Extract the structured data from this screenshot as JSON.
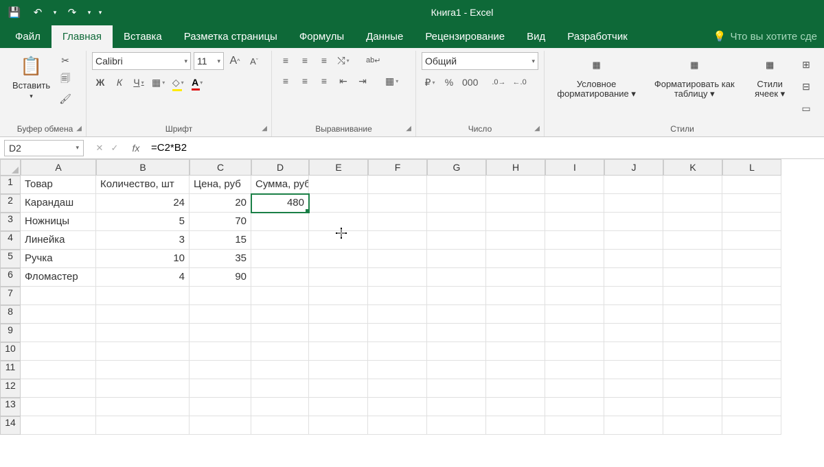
{
  "title": "Книга1  -  Excel",
  "qat_dropdown": "▾",
  "tabs": [
    "Файл",
    "Главная",
    "Вставка",
    "Разметка страницы",
    "Формулы",
    "Данные",
    "Рецензирование",
    "Вид",
    "Разработчик"
  ],
  "active_tab": 1,
  "tellme": "Что вы хотите сде",
  "clipboard": {
    "paste": "Вставить",
    "label": "Буфер обмена"
  },
  "font": {
    "name": "Calibri",
    "size": "11",
    "label": "Шрифт",
    "bold": "Ж",
    "italic": "К",
    "underline": "Ч",
    "bigger": "A",
    "smaller": "A"
  },
  "alignment": {
    "label": "Выравнивание",
    "wrap": "ab"
  },
  "number": {
    "format": "Общий",
    "label": "Число",
    "pct": "%",
    "comma": "000"
  },
  "styles": {
    "cond": "Условное форматирование",
    "table": "Форматировать как таблицу",
    "cell": "Стили ячеек",
    "label": "Стили"
  },
  "namebox": "D2",
  "formula": "=C2*B2",
  "columns": [
    "A",
    "B",
    "C",
    "D",
    "E",
    "F",
    "G",
    "H",
    "I",
    "J",
    "K",
    "L"
  ],
  "rows": 14,
  "data": {
    "A1": "Товар",
    "B1": "Количество, шт",
    "C1": "Цена, руб",
    "D1": "Сумма, руб",
    "A2": "Карандаш",
    "B2": 24,
    "C2": 20,
    "D2": 480,
    "A3": "Ножницы",
    "B3": 5,
    "C3": 70,
    "A4": "Линейка",
    "B4": 3,
    "C4": 15,
    "A5": "Ручка",
    "B5": 10,
    "C5": 35,
    "A6": "Фломастер",
    "B6": 4,
    "C6": 90
  },
  "selected": "D2"
}
